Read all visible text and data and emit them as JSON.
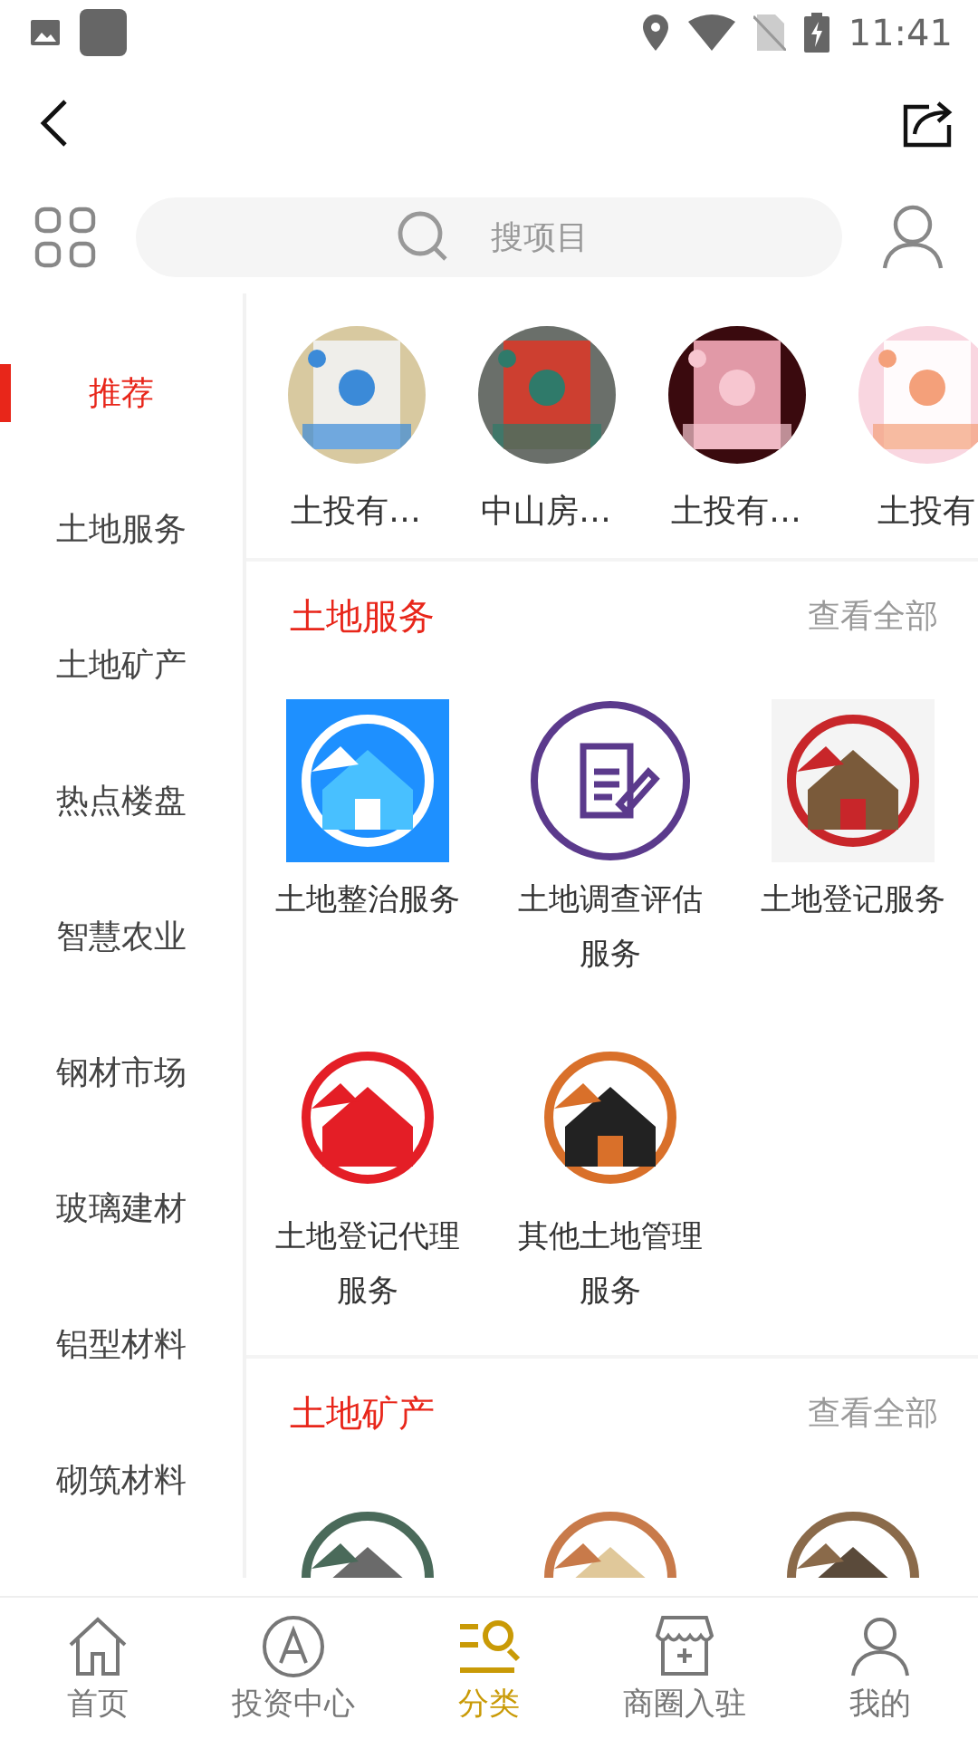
{
  "status_bar": {
    "time": "11:41"
  },
  "search": {
    "placeholder": "搜项目"
  },
  "sidebar": {
    "items": [
      {
        "label": "推荐",
        "selected": true
      },
      {
        "label": "土地服务",
        "selected": false
      },
      {
        "label": "土地矿产",
        "selected": false
      },
      {
        "label": "热点楼盘",
        "selected": false
      },
      {
        "label": "智慧农业",
        "selected": false
      },
      {
        "label": "钢材市场",
        "selected": false
      },
      {
        "label": "玻璃建材",
        "selected": false
      },
      {
        "label": "铝型材料",
        "selected": false
      },
      {
        "label": "砌筑材料",
        "selected": false
      }
    ]
  },
  "recommended": [
    {
      "label": "土投有…"
    },
    {
      "label": "中山房…"
    },
    {
      "label": "土投有…"
    },
    {
      "label": "土投有"
    }
  ],
  "sections": [
    {
      "title": "土地服务",
      "more": "查看全部",
      "items": [
        {
          "kind": "picture",
          "label": "土地整治服务"
        },
        {
          "kind": "icon",
          "label": "土地调查评估服务"
        },
        {
          "kind": "picture",
          "label": "土地登记服务"
        },
        {
          "kind": "picture",
          "label": "土地登记代理服务"
        },
        {
          "kind": "picture",
          "label": "其他土地管理服务"
        }
      ]
    },
    {
      "title": "土地矿产",
      "more": "查看全部"
    }
  ],
  "tab_bar": [
    {
      "label": "首页",
      "selected": false
    },
    {
      "label": "投资中心",
      "selected": false
    },
    {
      "label": "分类",
      "selected": true
    },
    {
      "label": "商圈入驻",
      "selected": false
    },
    {
      "label": "我的",
      "selected": false
    }
  ]
}
